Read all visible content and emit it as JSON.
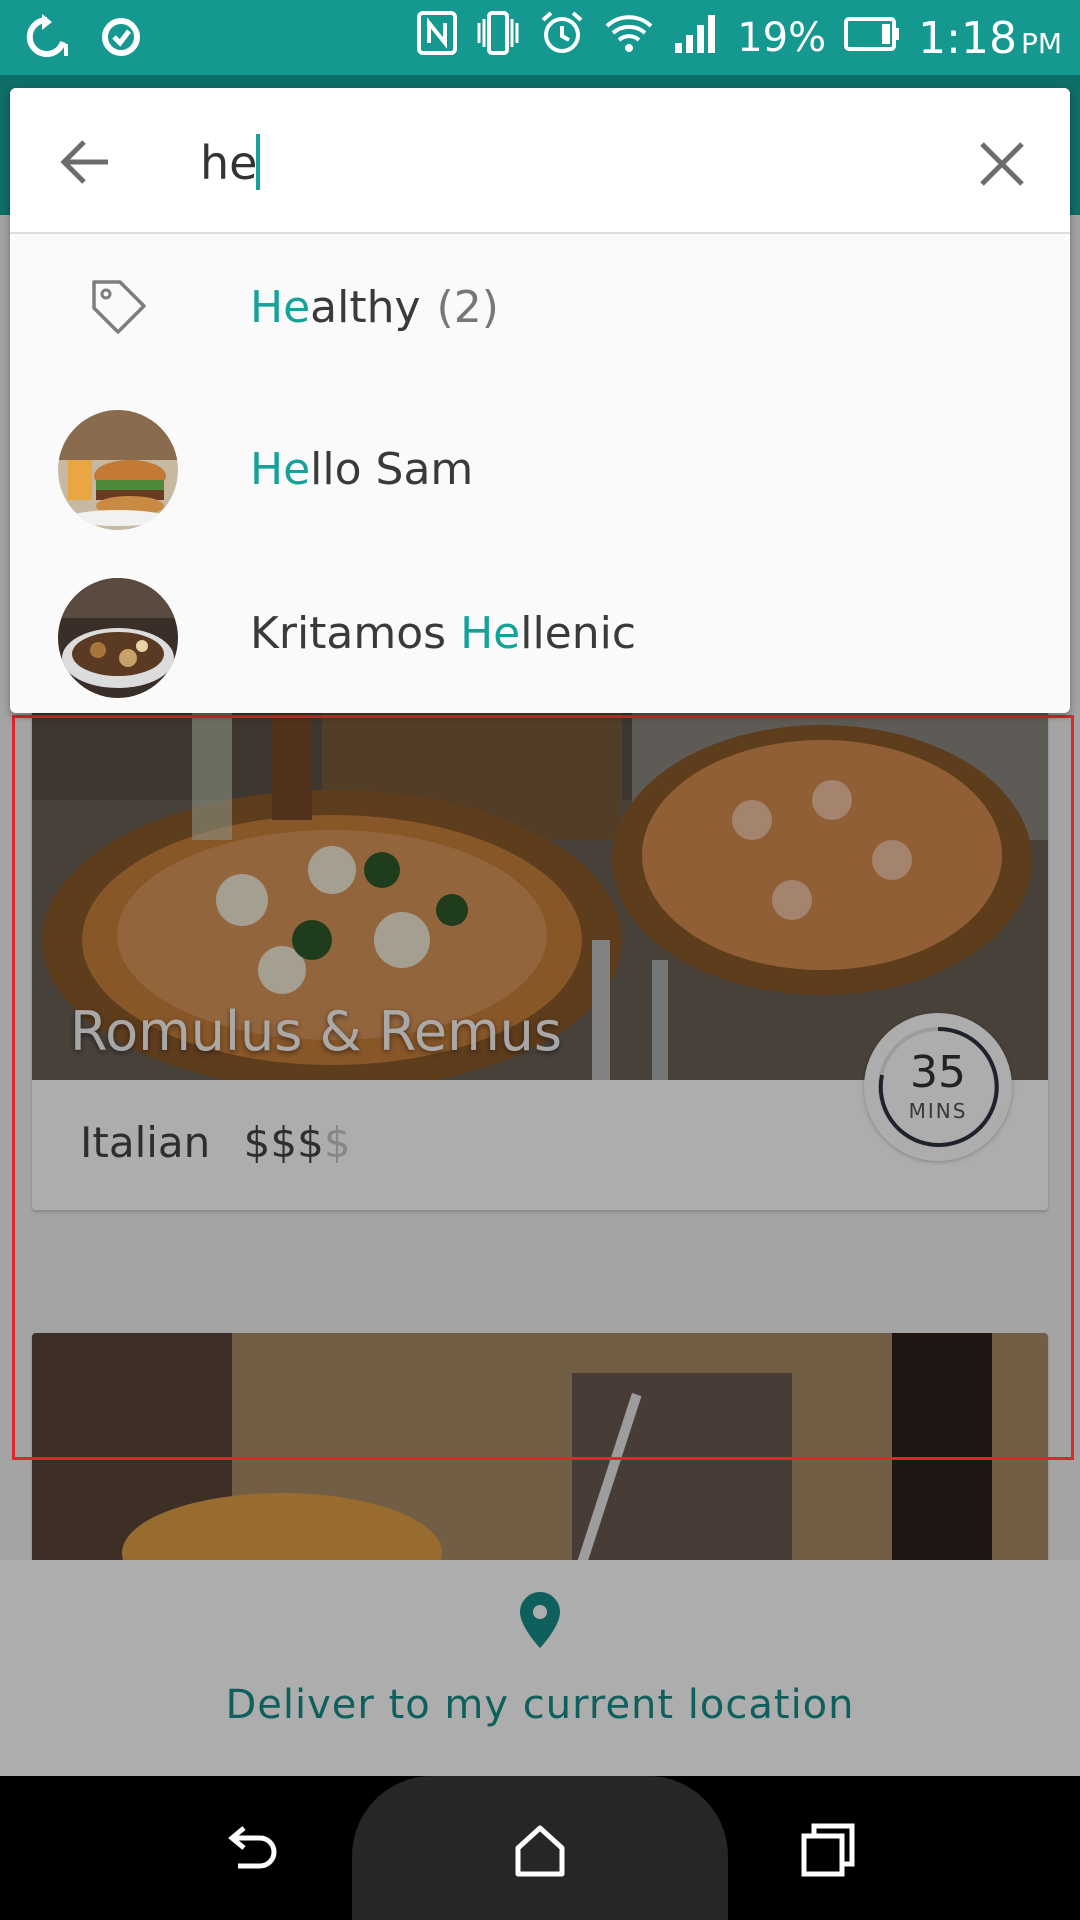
{
  "status_bar": {
    "battery_percent": "19%",
    "time": "1:18",
    "ampm": "PM",
    "icons": [
      "sync-icon",
      "sync-alert-icon",
      "nfc-icon",
      "vibrate-icon",
      "alarm-icon",
      "wifi-icon",
      "signal-icon",
      "battery-icon"
    ]
  },
  "search": {
    "query": "he",
    "back_icon": "arrow-left-icon",
    "clear_icon": "close-icon"
  },
  "suggestions": [
    {
      "type": "tag",
      "icon": "tag-icon",
      "highlight": "He",
      "rest": "althy",
      "count": "(2)"
    },
    {
      "type": "restaurant",
      "icon": "burger-avatar",
      "prefix": "",
      "highlight": "He",
      "rest": "llo Sam"
    },
    {
      "type": "restaurant",
      "icon": "greek-food-avatar",
      "prefix": "Kritamos ",
      "highlight": "He",
      "rest": "llenic"
    }
  ],
  "restaurant_card": {
    "name": "Romulus & Remus",
    "cuisine": "Italian",
    "price_active": "$$$",
    "price_inactive": "$",
    "eta_value": "35",
    "eta_unit": "MINS"
  },
  "deliver": {
    "icon": "location-pin-icon",
    "label": "Deliver to my current location"
  },
  "colors": {
    "accent": "#16a29a",
    "status_bar": "#14988f",
    "highlight_box": "#e0262d"
  }
}
